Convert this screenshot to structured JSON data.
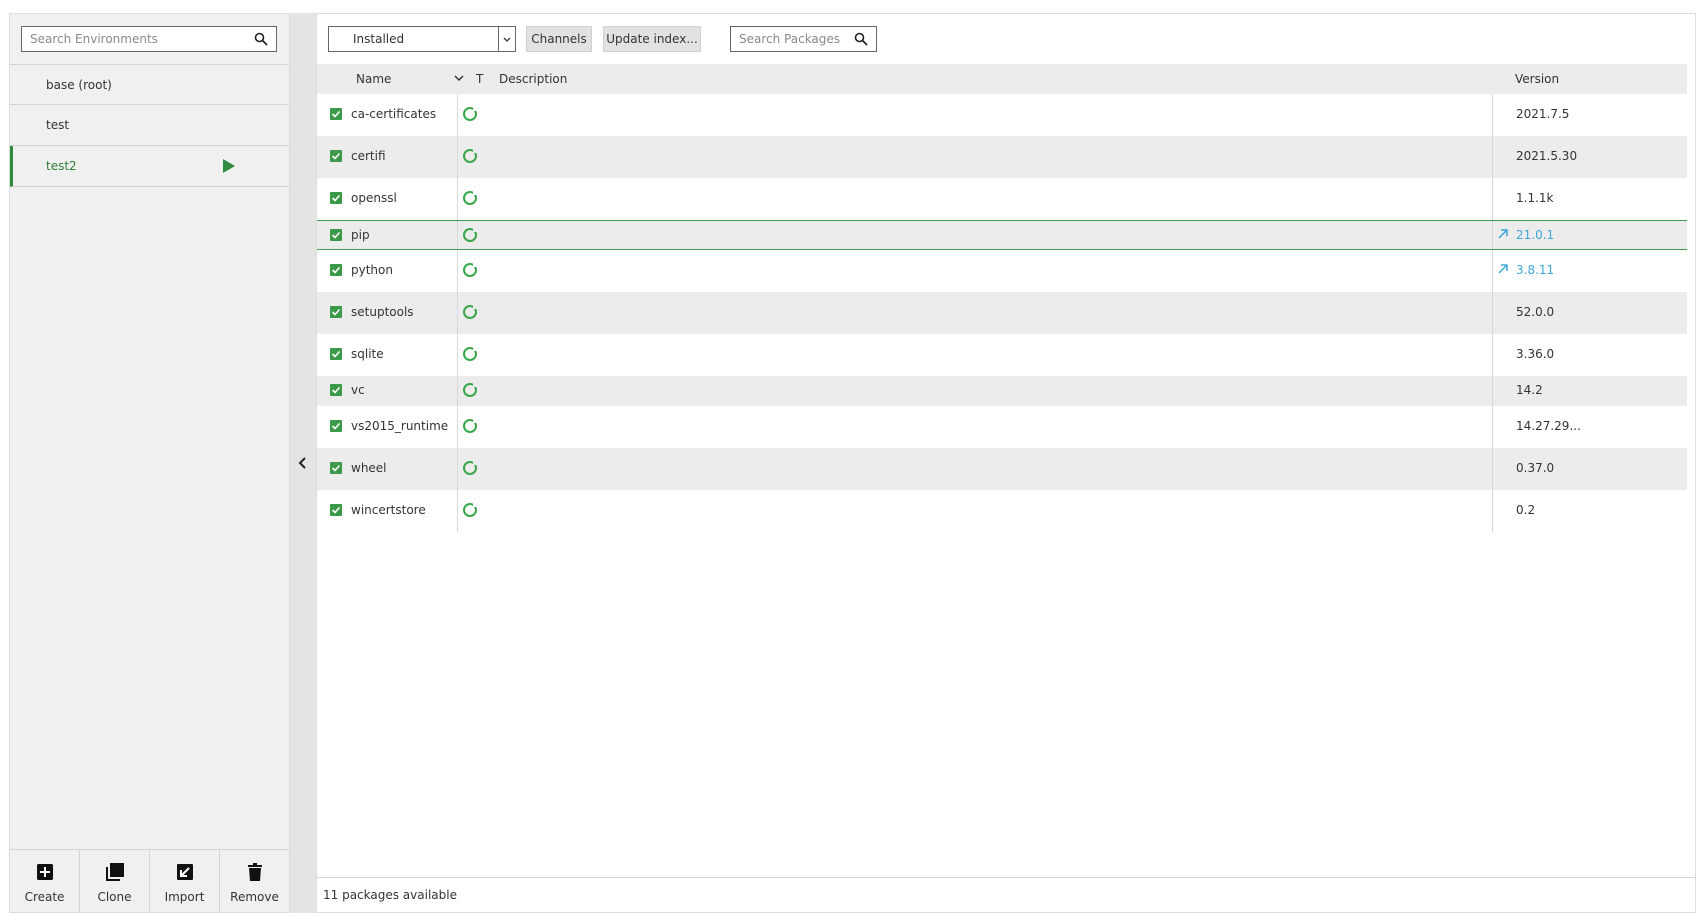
{
  "environments": {
    "search_placeholder": "Search Environments",
    "items": [
      {
        "label": "base (root)",
        "active": false
      },
      {
        "label": "test",
        "active": false
      },
      {
        "label": "test2",
        "active": true
      }
    ],
    "actions": [
      {
        "label": "Create",
        "icon": "plus-square-icon"
      },
      {
        "label": "Clone",
        "icon": "copy-icon"
      },
      {
        "label": "Import",
        "icon": "import-icon"
      },
      {
        "label": "Remove",
        "icon": "trash-icon"
      }
    ]
  },
  "toolbar": {
    "filter_value": "Installed",
    "channels_label": "Channels",
    "update_index_label": "Update index...",
    "search_placeholder": "Search Packages"
  },
  "table": {
    "headers": {
      "name": "Name",
      "type": "T",
      "description": "Description",
      "version": "Version"
    },
    "rows": [
      {
        "name": "ca-certificates",
        "version": "2021.7.5",
        "update": false
      },
      {
        "name": "certifi",
        "version": "2021.5.30",
        "update": false
      },
      {
        "name": "openssl",
        "version": "1.1.1k",
        "update": false
      },
      {
        "name": "pip",
        "version": "21.0.1",
        "update": true,
        "selected": true
      },
      {
        "name": "python",
        "version": "3.8.11",
        "update": true
      },
      {
        "name": "setuptools",
        "version": "52.0.0",
        "update": false
      },
      {
        "name": "sqlite",
        "version": "3.36.0",
        "update": false
      },
      {
        "name": "vc",
        "version": "14.2",
        "update": false
      },
      {
        "name": "vs2015_runtime",
        "version": "14.27.29...",
        "update": false
      },
      {
        "name": "wheel",
        "version": "0.37.0",
        "update": false
      },
      {
        "name": "wincertstore",
        "version": "0.2",
        "update": false
      }
    ]
  },
  "status": {
    "text": "11 packages available"
  },
  "colors": {
    "accent_green": "#3a9a4a",
    "update_blue": "#3aa8d8",
    "active_env": "#2e7d32"
  }
}
